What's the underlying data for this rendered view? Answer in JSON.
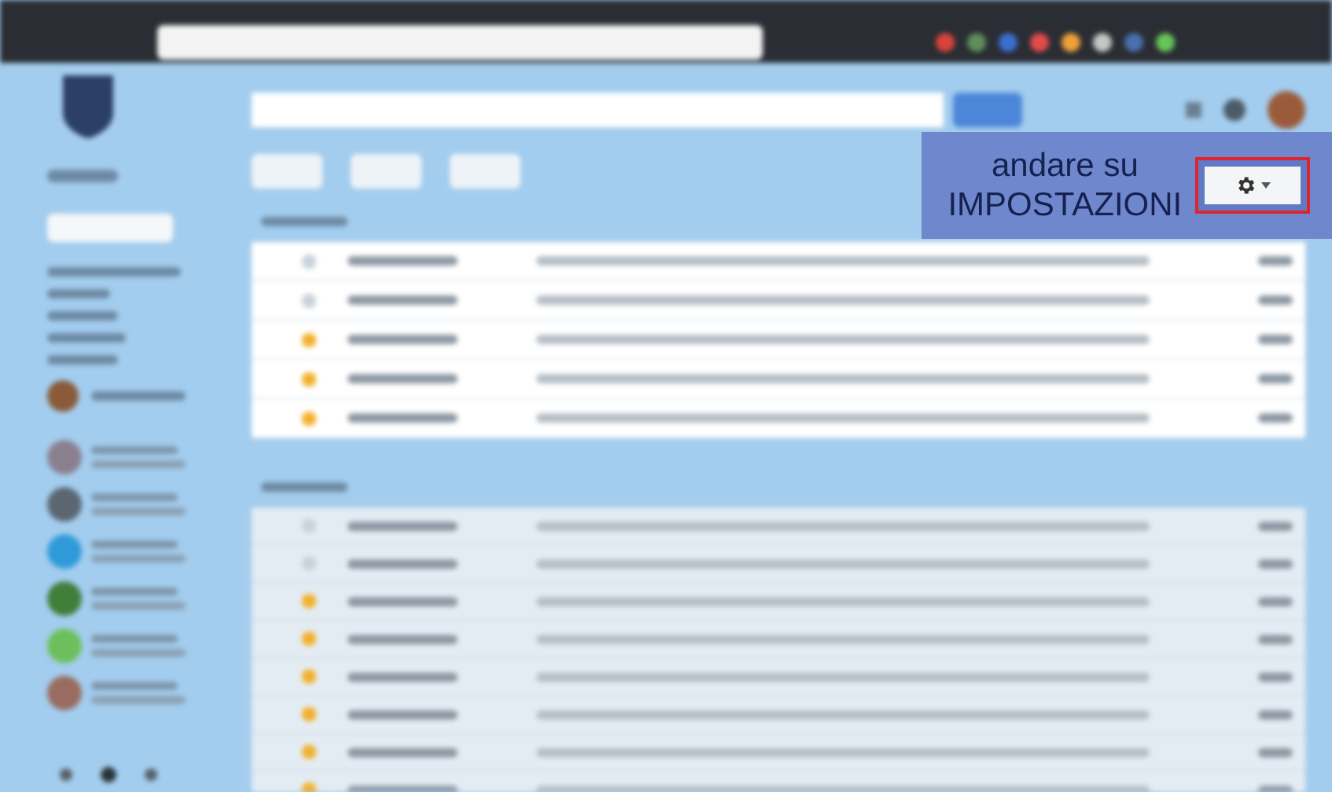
{
  "annotation": {
    "text": "andare su IMPOSTAZIONI"
  },
  "contacts": [
    {
      "color": "#8a7f8f"
    },
    {
      "color": "#5b6670"
    },
    {
      "color": "#2f9ad8"
    },
    {
      "color": "#3f7f3a"
    },
    {
      "color": "#6cbf5a"
    },
    {
      "color": "#9a6b60"
    }
  ],
  "sections": [
    {
      "rows": [
        {
          "starred": false
        },
        {
          "starred": false
        },
        {
          "starred": true
        },
        {
          "starred": true
        },
        {
          "starred": true
        }
      ]
    },
    {
      "rows": [
        {
          "starred": false
        },
        {
          "starred": false
        },
        {
          "starred": true
        },
        {
          "starred": true
        },
        {
          "starred": true
        },
        {
          "starred": true
        },
        {
          "starred": true
        },
        {
          "starred": true
        }
      ]
    }
  ]
}
